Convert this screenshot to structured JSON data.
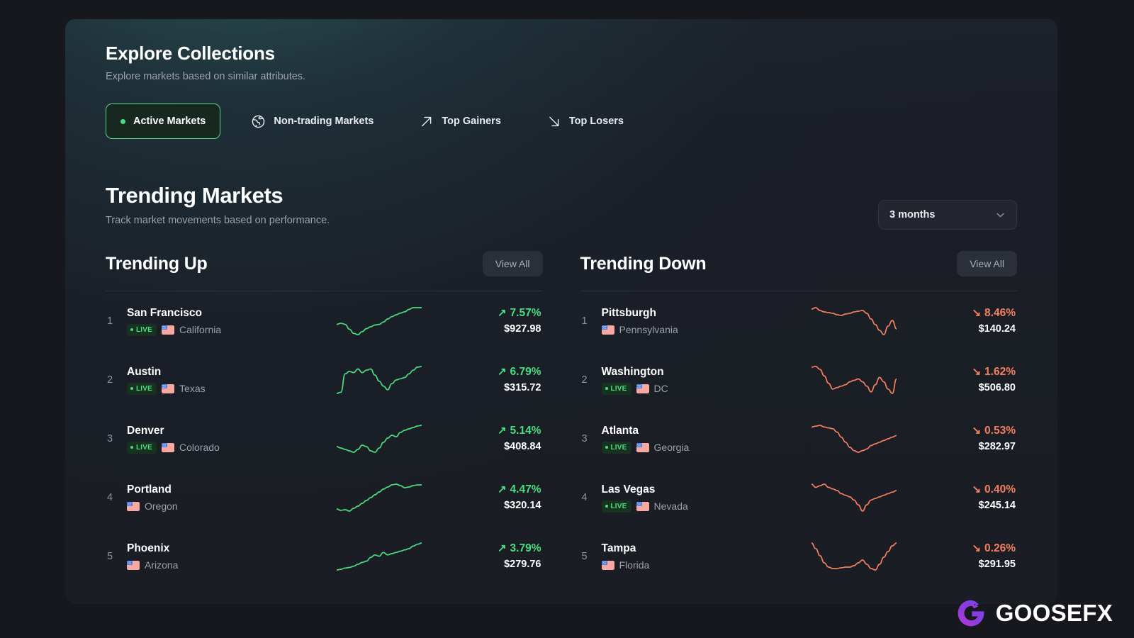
{
  "header": {
    "title": "Explore Collections",
    "subtitle": "Explore markets based on similar attributes."
  },
  "tabs": [
    {
      "label": "Active Markets",
      "icon": "green-dot-icon",
      "active": true
    },
    {
      "label": "Non-trading Markets",
      "icon": "globe-icon",
      "active": false
    },
    {
      "label": "Top Gainers",
      "icon": "arrow-up-right-icon",
      "active": false
    },
    {
      "label": "Top Losers",
      "icon": "arrow-down-right-icon",
      "active": false
    }
  ],
  "trending": {
    "title": "Trending Markets",
    "subtitle": "Track market movements based on performance.",
    "range_selected": "3 months",
    "range_chevron_icon": "chevron-down-icon"
  },
  "colors": {
    "up": "#4ade80",
    "down": "#f4805f",
    "accent_border": "#5fd18a",
    "card_bg": "#1a1d24",
    "page_bg": "#16181d"
  },
  "up_column": {
    "title": "Trending Up",
    "view_all_label": "View All",
    "rows": [
      {
        "rank": "1",
        "market": "San Francisco",
        "live": true,
        "live_label": "LIVE",
        "state": "California",
        "change": "7.57%",
        "arrow": "↗",
        "price": "$927.98",
        "direction": "up"
      },
      {
        "rank": "2",
        "market": "Austin",
        "live": true,
        "live_label": "LIVE",
        "state": "Texas",
        "change": "6.79%",
        "arrow": "↗",
        "price": "$315.72",
        "direction": "up"
      },
      {
        "rank": "3",
        "market": "Denver",
        "live": true,
        "live_label": "LIVE",
        "state": "Colorado",
        "change": "5.14%",
        "arrow": "↗",
        "price": "$408.84",
        "direction": "up"
      },
      {
        "rank": "4",
        "market": "Portland",
        "live": false,
        "live_label": "LIVE",
        "state": "Oregon",
        "change": "4.47%",
        "arrow": "↗",
        "price": "$320.14",
        "direction": "up"
      },
      {
        "rank": "5",
        "market": "Phoenix",
        "live": false,
        "live_label": "LIVE",
        "state": "Arizona",
        "change": "3.79%",
        "arrow": "↗",
        "price": "$279.76",
        "direction": "up"
      }
    ]
  },
  "down_column": {
    "title": "Trending Down",
    "view_all_label": "View All",
    "rows": [
      {
        "rank": "1",
        "market": "Pittsburgh",
        "live": false,
        "live_label": "LIVE",
        "state": "Pennsylvania",
        "change": "8.46%",
        "arrow": "↘",
        "price": "$140.24",
        "direction": "down"
      },
      {
        "rank": "2",
        "market": "Washington",
        "live": true,
        "live_label": "LIVE",
        "state": "DC",
        "change": "1.62%",
        "arrow": "↘",
        "price": "$506.80",
        "direction": "down"
      },
      {
        "rank": "3",
        "market": "Atlanta",
        "live": true,
        "live_label": "LIVE",
        "state": "Georgia",
        "change": "0.53%",
        "arrow": "↘",
        "price": "$282.97",
        "direction": "down"
      },
      {
        "rank": "4",
        "market": "Las Vegas",
        "live": true,
        "live_label": "LIVE",
        "state": "Nevada",
        "change": "0.40%",
        "arrow": "↘",
        "price": "$245.14",
        "direction": "down"
      },
      {
        "rank": "5",
        "market": "Tampa",
        "live": false,
        "live_label": "LIVE",
        "state": "Florida",
        "change": "0.26%",
        "arrow": "↘",
        "price": "$291.95",
        "direction": "down"
      }
    ]
  },
  "sparklines": {
    "up": [
      [
        40,
        38,
        40,
        48,
        55,
        57,
        52,
        47,
        44,
        41,
        40,
        36,
        31,
        27,
        24,
        21,
        19,
        15,
        12,
        12,
        12
      ],
      [
        52,
        50,
        20,
        16,
        18,
        12,
        18,
        14,
        12,
        22,
        32,
        40,
        46,
        36,
        30,
        28,
        26,
        20,
        14,
        9,
        8
      ],
      [
        36,
        38,
        40,
        42,
        44,
        40,
        34,
        36,
        42,
        44,
        38,
        30,
        24,
        20,
        22,
        16,
        13,
        11,
        9,
        7,
        6
      ],
      [
        44,
        46,
        45,
        47,
        43,
        40,
        36,
        32,
        28,
        24,
        20,
        16,
        13,
        10,
        9,
        11,
        14,
        13,
        11,
        10,
        10
      ],
      [
        50,
        49,
        47,
        46,
        44,
        41,
        38,
        36,
        30,
        26,
        28,
        22,
        26,
        24,
        22,
        20,
        18,
        16,
        12,
        9,
        7
      ]
    ],
    "down": [
      [
        16,
        14,
        18,
        20,
        21,
        22,
        24,
        25,
        23,
        22,
        20,
        19,
        18,
        22,
        30,
        38,
        46,
        52,
        40,
        32,
        44
      ],
      [
        10,
        9,
        13,
        22,
        32,
        40,
        38,
        36,
        34,
        30,
        28,
        26,
        30,
        36,
        44,
        34,
        24,
        30,
        40,
        46,
        26
      ],
      [
        16,
        15,
        14,
        16,
        17,
        18,
        22,
        28,
        34,
        40,
        44,
        46,
        44,
        42,
        38,
        36,
        34,
        32,
        30,
        28,
        26
      ],
      [
        14,
        18,
        16,
        14,
        18,
        20,
        22,
        26,
        28,
        30,
        34,
        40,
        48,
        40,
        34,
        32,
        30,
        28,
        26,
        24,
        22
      ],
      [
        10,
        18,
        28,
        38,
        44,
        46,
        46,
        45,
        44,
        44,
        42,
        38,
        34,
        40,
        46,
        48,
        40,
        30,
        22,
        14,
        10
      ]
    ]
  },
  "logo": {
    "text": "GOOSEFX",
    "mark_icon": "goosefx-g-icon"
  }
}
